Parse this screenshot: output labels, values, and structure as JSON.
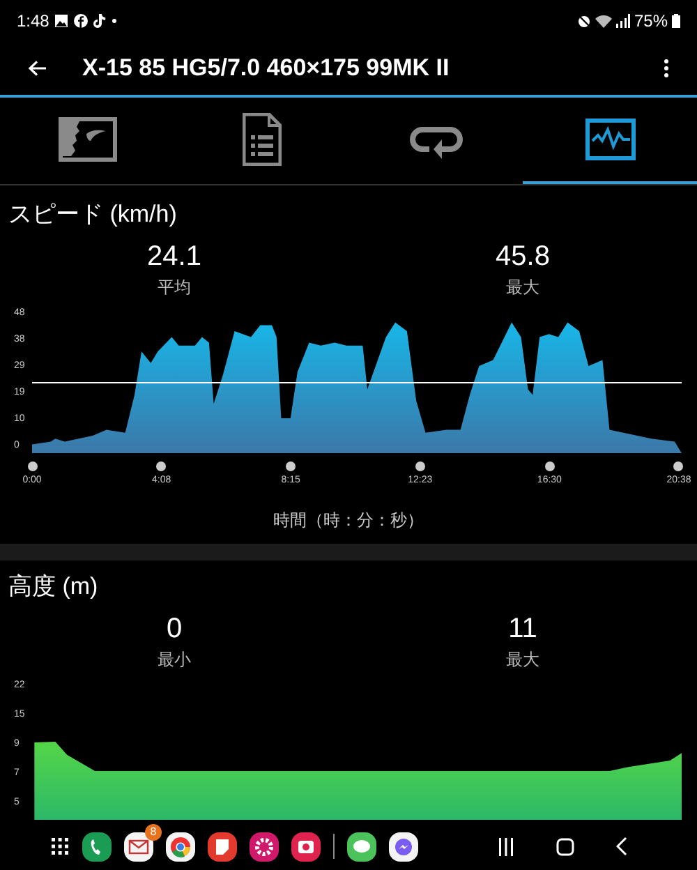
{
  "status_bar": {
    "time": "1:48",
    "battery": "75%"
  },
  "app_bar": {
    "title": "X-15 85 HG5/7.0 460×175 99MK II"
  },
  "tabs": [
    {
      "kind": "map",
      "selected": false
    },
    {
      "kind": "sheet",
      "selected": false
    },
    {
      "kind": "loop",
      "selected": false
    },
    {
      "kind": "graph",
      "selected": true
    }
  ],
  "sections": [
    {
      "kind": "speed",
      "title": "スピード (km/h)",
      "stats": [
        {
          "value": "24.1",
          "label": "平均"
        },
        {
          "value": "45.8",
          "label": "最大"
        }
      ],
      "y_ticks": [
        "48",
        "38",
        "29",
        "19",
        "10",
        "0"
      ],
      "x_ticks": [
        "0:00",
        "4:08",
        "8:15",
        "12:23",
        "16:30",
        "20:38"
      ],
      "x_title": "時間（時：分：秒）"
    },
    {
      "kind": "altitude",
      "title": "高度 (m)",
      "stats": [
        {
          "value": "0",
          "label": "最小"
        },
        {
          "value": "11",
          "label": "最大"
        }
      ],
      "y_ticks": [
        "22",
        "15",
        "9",
        "7",
        "5"
      ]
    }
  ],
  "taskbar": {
    "mail_badge": "8"
  }
}
